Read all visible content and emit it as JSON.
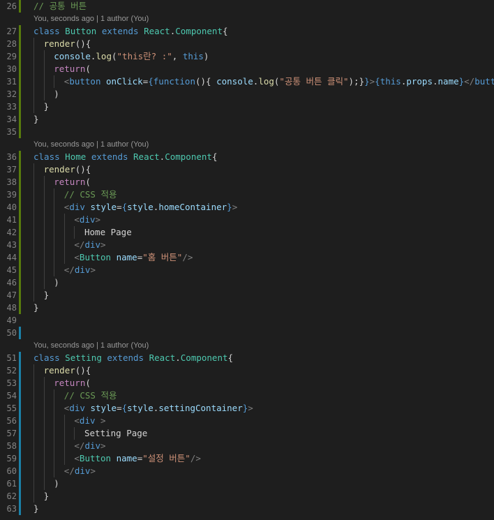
{
  "lens_text": "You, seconds ago | 1 author (You)",
  "lines": [
    {
      "n": "26",
      "bar": "green",
      "indent": 0,
      "tokens": [
        [
          "com",
          "// 공통 버튼"
        ]
      ]
    },
    {
      "lens": true
    },
    {
      "n": "27",
      "bar": "green",
      "indent": 0,
      "tokens": [
        [
          "kw",
          "class"
        ],
        [
          "p",
          " "
        ],
        [
          "cls",
          "Button"
        ],
        [
          "p",
          " "
        ],
        [
          "kw",
          "extends"
        ],
        [
          "p",
          " "
        ],
        [
          "cls",
          "React"
        ],
        [
          "p",
          "."
        ],
        [
          "cls",
          "Component"
        ],
        [
          "p",
          "{"
        ]
      ]
    },
    {
      "n": "28",
      "bar": "green",
      "indent": 1,
      "tokens": [
        [
          "fn",
          "render"
        ],
        [
          "p",
          "(){"
        ]
      ]
    },
    {
      "n": "29",
      "bar": "green",
      "indent": 2,
      "tokens": [
        [
          "var",
          "console"
        ],
        [
          "p",
          "."
        ],
        [
          "fn",
          "log"
        ],
        [
          "p",
          "("
        ],
        [
          "str",
          "\"this란? :\""
        ],
        [
          "p",
          ", "
        ],
        [
          "kw",
          "this"
        ],
        [
          "p",
          ")"
        ]
      ]
    },
    {
      "n": "30",
      "bar": "green",
      "indent": 2,
      "tokens": [
        [
          "ctl",
          "return"
        ],
        [
          "p",
          "("
        ]
      ]
    },
    {
      "n": "31",
      "bar": "green",
      "indent": 3,
      "tokens": [
        [
          "br",
          "<"
        ],
        [
          "tag",
          "button"
        ],
        [
          "p",
          " "
        ],
        [
          "var",
          "onClick"
        ],
        [
          "p",
          "="
        ],
        [
          "kw",
          "{"
        ],
        [
          "kw",
          "function"
        ],
        [
          "p",
          "(){ "
        ],
        [
          "var",
          "console"
        ],
        [
          "p",
          "."
        ],
        [
          "fn",
          "log"
        ],
        [
          "p",
          "("
        ],
        [
          "str",
          "\"공통 버튼 클릭\""
        ],
        [
          "p",
          ");}"
        ],
        [
          "kw",
          "}"
        ],
        [
          "br",
          ">"
        ],
        [
          "kw",
          "{"
        ],
        [
          "kw",
          "this"
        ],
        [
          "p",
          "."
        ],
        [
          "var",
          "props"
        ],
        [
          "p",
          "."
        ],
        [
          "var",
          "name"
        ],
        [
          "kw",
          "}"
        ],
        [
          "br",
          "</"
        ],
        [
          "tag",
          "button"
        ],
        [
          "br",
          ">"
        ]
      ]
    },
    {
      "n": "32",
      "bar": "green",
      "indent": 2,
      "tokens": [
        [
          "p",
          ")"
        ]
      ]
    },
    {
      "n": "33",
      "bar": "green",
      "indent": 1,
      "tokens": [
        [
          "p",
          "}"
        ]
      ]
    },
    {
      "n": "34",
      "bar": "green",
      "indent": 0,
      "tokens": [
        [
          "p",
          "}"
        ]
      ]
    },
    {
      "n": "35",
      "bar": "green",
      "indent": 0,
      "tokens": []
    },
    {
      "lens": true
    },
    {
      "n": "36",
      "bar": "green",
      "indent": 0,
      "tokens": [
        [
          "kw",
          "class"
        ],
        [
          "p",
          " "
        ],
        [
          "cls",
          "Home"
        ],
        [
          "p",
          " "
        ],
        [
          "kw",
          "extends"
        ],
        [
          "p",
          " "
        ],
        [
          "cls",
          "React"
        ],
        [
          "p",
          "."
        ],
        [
          "cls",
          "Component"
        ],
        [
          "p",
          "{"
        ]
      ]
    },
    {
      "n": "37",
      "bar": "green",
      "indent": 1,
      "tokens": [
        [
          "fn",
          "render"
        ],
        [
          "p",
          "(){"
        ]
      ]
    },
    {
      "n": "38",
      "bar": "green",
      "indent": 2,
      "tokens": [
        [
          "ctl",
          "return"
        ],
        [
          "p",
          "("
        ]
      ]
    },
    {
      "n": "39",
      "bar": "green",
      "indent": 3,
      "tokens": [
        [
          "com",
          "// CSS 적용"
        ]
      ]
    },
    {
      "n": "40",
      "bar": "green",
      "indent": 3,
      "tokens": [
        [
          "br",
          "<"
        ],
        [
          "tag",
          "div"
        ],
        [
          "p",
          " "
        ],
        [
          "var",
          "style"
        ],
        [
          "p",
          "="
        ],
        [
          "kw",
          "{"
        ],
        [
          "var",
          "style"
        ],
        [
          "p",
          "."
        ],
        [
          "var",
          "homeContainer"
        ],
        [
          "kw",
          "}"
        ],
        [
          "br",
          ">"
        ]
      ]
    },
    {
      "n": "41",
      "bar": "green",
      "indent": 4,
      "tokens": [
        [
          "br",
          "<"
        ],
        [
          "tag",
          "div"
        ],
        [
          "br",
          ">"
        ]
      ]
    },
    {
      "n": "42",
      "bar": "green",
      "indent": 5,
      "tokens": [
        [
          "txt",
          "Home Page"
        ]
      ]
    },
    {
      "n": "43",
      "bar": "green",
      "indent": 4,
      "tokens": [
        [
          "br",
          "</"
        ],
        [
          "tag",
          "div"
        ],
        [
          "br",
          ">"
        ]
      ]
    },
    {
      "n": "44",
      "bar": "green",
      "indent": 4,
      "tokens": [
        [
          "br",
          "<"
        ],
        [
          "cls",
          "Button"
        ],
        [
          "p",
          " "
        ],
        [
          "var",
          "name"
        ],
        [
          "p",
          "="
        ],
        [
          "str",
          "\"홈 버튼\""
        ],
        [
          "br",
          "/>"
        ]
      ]
    },
    {
      "n": "45",
      "bar": "green",
      "indent": 3,
      "tokens": [
        [
          "br",
          "</"
        ],
        [
          "tag",
          "div"
        ],
        [
          "br",
          ">"
        ]
      ]
    },
    {
      "n": "46",
      "bar": "green",
      "indent": 2,
      "tokens": [
        [
          "p",
          ")"
        ]
      ]
    },
    {
      "n": "47",
      "bar": "green",
      "indent": 1,
      "tokens": [
        [
          "p",
          "}"
        ]
      ]
    },
    {
      "n": "48",
      "bar": "green",
      "indent": 0,
      "tokens": [
        [
          "p",
          "}"
        ]
      ]
    },
    {
      "n": "49",
      "bar": "",
      "indent": 0,
      "tokens": []
    },
    {
      "n": "50",
      "bar": "blue",
      "indent": 0,
      "tokens": []
    },
    {
      "lens": true
    },
    {
      "n": "51",
      "bar": "blue",
      "indent": 0,
      "tokens": [
        [
          "kw",
          "class"
        ],
        [
          "p",
          " "
        ],
        [
          "cls",
          "Setting"
        ],
        [
          "p",
          " "
        ],
        [
          "kw",
          "extends"
        ],
        [
          "p",
          " "
        ],
        [
          "cls",
          "React"
        ],
        [
          "p",
          "."
        ],
        [
          "cls",
          "Component"
        ],
        [
          "p",
          "{"
        ]
      ]
    },
    {
      "n": "52",
      "bar": "blue",
      "indent": 1,
      "tokens": [
        [
          "fn",
          "render"
        ],
        [
          "p",
          "(){"
        ]
      ]
    },
    {
      "n": "53",
      "bar": "blue",
      "indent": 2,
      "tokens": [
        [
          "ctl",
          "return"
        ],
        [
          "p",
          "("
        ]
      ]
    },
    {
      "n": "54",
      "bar": "blue",
      "indent": 3,
      "tokens": [
        [
          "com",
          "// CSS 적용"
        ]
      ]
    },
    {
      "n": "55",
      "bar": "blue",
      "indent": 3,
      "tokens": [
        [
          "br",
          "<"
        ],
        [
          "tag",
          "div"
        ],
        [
          "p",
          " "
        ],
        [
          "var",
          "style"
        ],
        [
          "p",
          "="
        ],
        [
          "kw",
          "{"
        ],
        [
          "var",
          "style"
        ],
        [
          "p",
          "."
        ],
        [
          "var",
          "settingContainer"
        ],
        [
          "kw",
          "}"
        ],
        [
          "br",
          ">"
        ]
      ]
    },
    {
      "n": "56",
      "bar": "blue",
      "indent": 4,
      "tokens": [
        [
          "br",
          "<"
        ],
        [
          "tag",
          "div"
        ],
        [
          "p",
          " "
        ],
        [
          "br",
          ">"
        ]
      ]
    },
    {
      "n": "57",
      "bar": "blue",
      "indent": 5,
      "tokens": [
        [
          "txt",
          "Setting Page"
        ]
      ]
    },
    {
      "n": "58",
      "bar": "blue",
      "indent": 4,
      "tokens": [
        [
          "br",
          "</"
        ],
        [
          "tag",
          "div"
        ],
        [
          "br",
          ">"
        ]
      ]
    },
    {
      "n": "59",
      "bar": "blue",
      "indent": 4,
      "tokens": [
        [
          "br",
          "<"
        ],
        [
          "cls",
          "Button"
        ],
        [
          "p",
          " "
        ],
        [
          "var",
          "name"
        ],
        [
          "p",
          "="
        ],
        [
          "str",
          "\"설정 버튼\""
        ],
        [
          "br",
          "/>"
        ]
      ]
    },
    {
      "n": "60",
      "bar": "blue",
      "indent": 3,
      "tokens": [
        [
          "br",
          "</"
        ],
        [
          "tag",
          "div"
        ],
        [
          "br",
          ">"
        ]
      ]
    },
    {
      "n": "61",
      "bar": "blue",
      "indent": 2,
      "tokens": [
        [
          "p",
          ")"
        ]
      ]
    },
    {
      "n": "62",
      "bar": "blue",
      "indent": 1,
      "tokens": [
        [
          "p",
          "}"
        ]
      ]
    },
    {
      "n": "63",
      "bar": "blue",
      "indent": 0,
      "tokens": [
        [
          "p",
          "}"
        ]
      ]
    }
  ]
}
